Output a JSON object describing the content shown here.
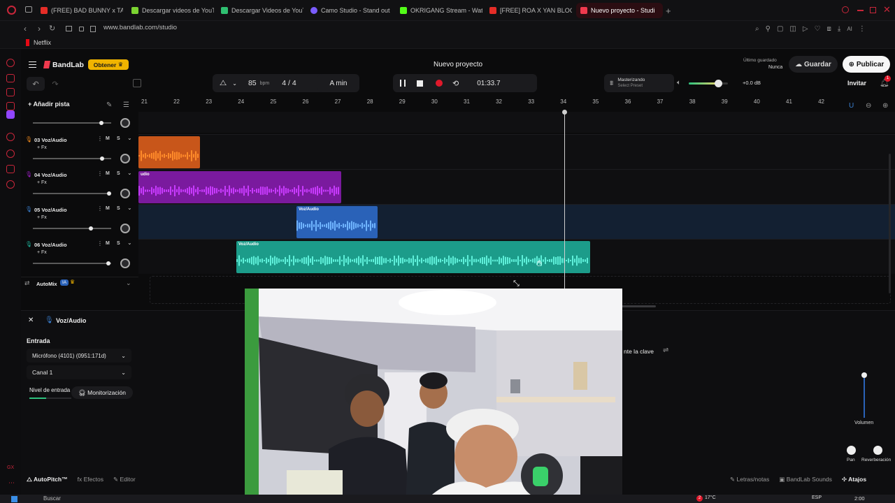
{
  "browser": {
    "tabs": [
      {
        "label": "(FREE) BAD BUNNY x TAI",
        "color": "#e52d27"
      },
      {
        "label": "Descargar videos de YouT",
        "color": "#7bd331"
      },
      {
        "label": "Descargar Videos de YouT",
        "color": "#2fbf71"
      },
      {
        "label": "Camo Studio - Stand out",
        "color": "#7a5cff"
      },
      {
        "label": "OKRIGANG Stream - Watc",
        "color": "#53fc18"
      },
      {
        "label": "[FREE] ROA X YAN BLOCK",
        "color": "#e52d27"
      },
      {
        "label": "Nuevo proyecto - Studi",
        "color": "#f03a4e"
      }
    ],
    "url": "www.bandlab.com/studio",
    "bookmark": "Netflix",
    "extras_label": "AI"
  },
  "app": {
    "brand": "BandLab",
    "upgrade_label": "Obtener",
    "project_title": "Nuevo proyecto",
    "saved_label": "Último guardado",
    "saved_value": "Nunca",
    "save_button": "Guardar",
    "publish_button": "Publicar",
    "invite_button": "Invitar",
    "notification_count": "1"
  },
  "transport": {
    "bpm": "85",
    "bpm_unit": "bpm",
    "time_signature": "4 / 4",
    "key": "A min",
    "time": "01:33.7",
    "mastering_label": "Masterizando",
    "mastering_preset": "Select Preset",
    "volume_db": "+0.0 dB",
    "volume_level": 0.75
  },
  "timeline": {
    "add_track": "Añadir pista",
    "ruler": [
      "21",
      "22",
      "23",
      "24",
      "25",
      "26",
      "27",
      "28",
      "29",
      "30",
      "31",
      "32",
      "33",
      "34",
      "35",
      "36",
      "37",
      "38",
      "39",
      "40",
      "41",
      "42"
    ],
    "tracks": [
      {
        "name": "03 Voz/Audio",
        "fx": "+ Fx",
        "m": "M",
        "s": "S",
        "icon_color": "#f28a1c",
        "volume": 0.88
      },
      {
        "name": "04 Voz/Audio",
        "fx": "+ Fx",
        "m": "M",
        "s": "S",
        "icon_color": "#a020c8",
        "volume": 0.97
      },
      {
        "name": "05 Voz/Audio",
        "fx": "+ Fx",
        "m": "M",
        "s": "S",
        "icon_color": "#3a7fd0",
        "volume": 0.74
      },
      {
        "name": "06 Voz/Audio",
        "fx": "+ Fx",
        "m": "M",
        "s": "S",
        "icon_color": "#1fb39c",
        "volume": 0.96
      }
    ],
    "clips": [
      {
        "label": "",
        "color": "#c8561a",
        "wave": "#ff8a2a"
      },
      {
        "label": "udio",
        "color": "#7a1a9e",
        "wave": "#c93bff"
      },
      {
        "label": "Voz/Audio",
        "color": "#2a62b8",
        "wave": "#6fb4ff"
      },
      {
        "label": "Voz/Audio",
        "color": "#1c9c8a",
        "wave": "#5ff0da"
      }
    ],
    "automix_label": "AutoMix",
    "automix_badge": "IA"
  },
  "panel": {
    "track_label": "Voz/Audio",
    "input_heading": "Entrada",
    "mic_value": "Micrófono (4101) (0951:171d)",
    "channel_value": "Canal 1",
    "level_label": "Nivel de entrada",
    "monitor_label": "Monitorización",
    "key_label": "nte la clave",
    "volume_label": "Volumen",
    "pan_label": "Pan",
    "reverb_label": "Reverberación",
    "tabs": [
      "AutoPitch™",
      "Efectos",
      "Editor"
    ],
    "right_tabs": [
      "Letras/notas",
      "BandLab Sounds",
      "Atajos"
    ]
  },
  "taskbar": {
    "search": "Buscar",
    "temperature": "17°C",
    "badge": "2",
    "lang": "ESP",
    "clock": "2:00"
  }
}
